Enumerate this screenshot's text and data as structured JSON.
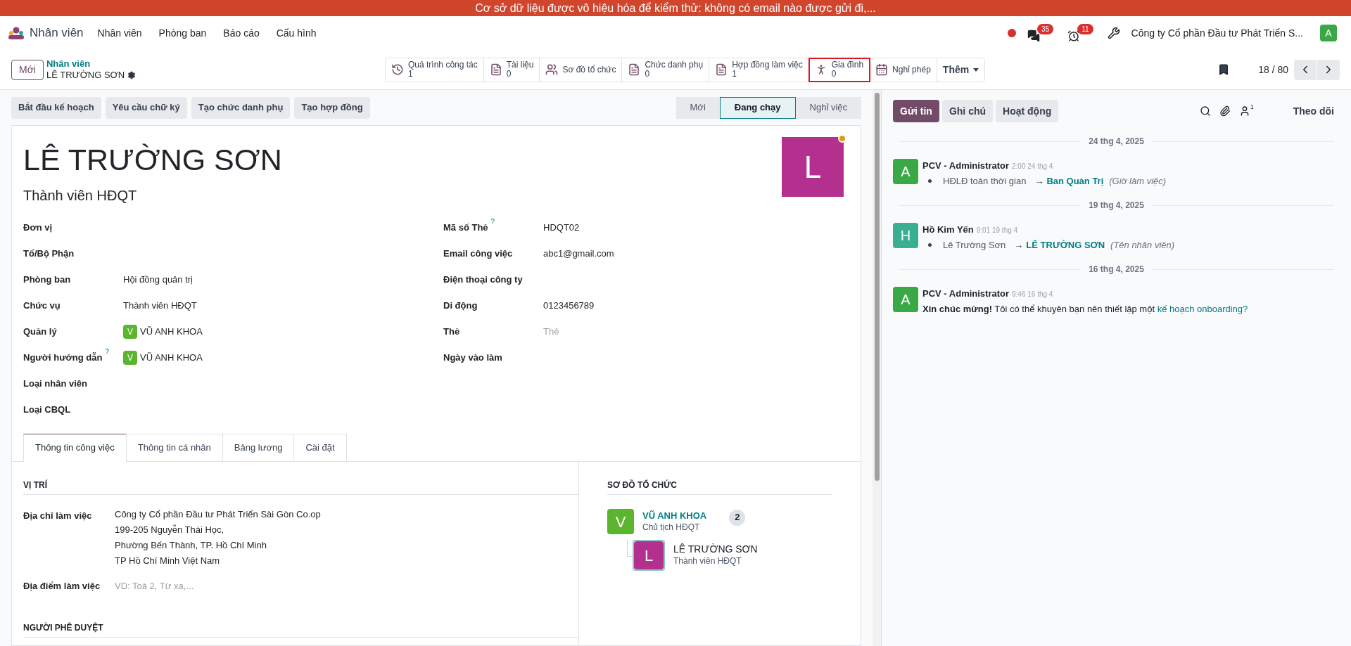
{
  "banner": "Cơ sở dữ liệu được vô hiệu hóa để kiểm thử: không có email nào được gửi đi,...",
  "navbar": {
    "app": "Nhân viên",
    "menu": [
      "Nhân viên",
      "Phòng ban",
      "Báo cáo",
      "Cấu hình"
    ],
    "messages_badge": "35",
    "activities_badge": "11",
    "company": "Công ty Cổ phần Đầu tư Phát Triển S...",
    "user_avatar": "A"
  },
  "control_panel": {
    "new_button": "Mới",
    "breadcrumb": "Nhân viên",
    "record": "LÊ TRƯỜNG SƠN",
    "pager": "18 / 80",
    "smart_buttons": [
      {
        "kind": "stat",
        "label": "Quá trình công tác",
        "count": "1",
        "highlighted": false
      },
      {
        "kind": "stat",
        "label": "Tài liệu",
        "count": "0",
        "highlighted": false
      },
      {
        "kind": "plain",
        "label": "Sơ đồ tổ chức",
        "highlighted": false
      },
      {
        "kind": "stat",
        "label": "Chức danh phụ",
        "count": "0",
        "highlighted": false
      },
      {
        "kind": "stat",
        "label": "Hợp đồng làm việc",
        "count": "1",
        "highlighted": false
      },
      {
        "kind": "stat",
        "label": "Gia đình",
        "count": "0",
        "highlighted": true
      },
      {
        "kind": "plain",
        "label": "Nghỉ phép",
        "highlighted": false
      },
      {
        "kind": "more",
        "label": "Thêm",
        "highlighted": false
      }
    ]
  },
  "action_buttons": [
    "Bắt đầu kế hoạch",
    "Yêu cầu chữ ký",
    "Tạo chức danh phụ",
    "Tạo hợp đồng"
  ],
  "status_stages": [
    {
      "label": "Mới",
      "selected": false
    },
    {
      "label": "Đang chạy",
      "selected": true
    },
    {
      "label": "Nghỉ việc",
      "selected": false
    }
  ],
  "employee": {
    "name": "LÊ TRƯỜNG SƠN",
    "job_title": "Thành viên HĐQT",
    "avatar": "L",
    "status_dot": true
  },
  "fields_left": [
    {
      "kind": "text",
      "label": "Đơn vị"
    },
    {
      "kind": "text",
      "label": "Tổ/Bộ Phận"
    },
    {
      "kind": "text",
      "label": "Phòng ban",
      "value": "Hội đồng quản trị"
    },
    {
      "kind": "text",
      "label": "Chức vụ",
      "value": "Thành viên HĐQT"
    },
    {
      "kind": "person",
      "label": "Quản lý",
      "avatar": "V",
      "value": "VŨ ANH KHOA"
    },
    {
      "kind": "person",
      "label": "Người hướng dẫn",
      "help": "?",
      "avatar": "V",
      "value": "VŨ ANH KHOA"
    },
    {
      "kind": "text",
      "label": "Loại nhân viên"
    },
    {
      "kind": "text",
      "label": "Loại CBQL"
    }
  ],
  "fields_right": [
    {
      "kind": "text",
      "label": "Mã số Thẻ",
      "help": "?",
      "value": "HDQT02"
    },
    {
      "kind": "text",
      "label": "Email công việc",
      "value": "abc1@gmail.com"
    },
    {
      "kind": "text",
      "label": "Điện thoại công ty"
    },
    {
      "kind": "text",
      "label": "Di động",
      "value": "0123456789"
    },
    {
      "kind": "placeholder",
      "label": "Thẻ",
      "placeholder": "Thẻ"
    },
    {
      "kind": "text",
      "label": "Ngày vào làm"
    }
  ],
  "tabs": [
    {
      "label": "Thông tin công việc",
      "selected": true
    },
    {
      "label": "Thông tin cá nhân",
      "selected": false
    },
    {
      "label": "Bảng lương",
      "selected": false
    },
    {
      "label": "Cài đặt",
      "selected": false
    }
  ],
  "work_info": {
    "section_position": "VỊ TRÍ",
    "address_label": "Địa chỉ làm việc",
    "address_lines": [
      "Công ty Cổ phần Đầu tư Phát Triển Sài Gòn Co.op",
      "199-205 Nguyễn Thái Học,",
      "Phường Bến Thành, TP. Hồ Chí Minh",
      "TP Hồ Chí Minh Việt Nam"
    ],
    "location_label": "Địa điểm làm việc",
    "location_placeholder": "VD: Toà 2, Từ xa,...",
    "section_approvers": "NGƯỜI PHÊ DUYỆT"
  },
  "org_chart": {
    "title": "SƠ ĐỒ TỔ CHỨC",
    "manager": {
      "avatar": "V",
      "name": "VŨ ANH KHOA",
      "title": "Chủ tịch HĐQT",
      "count": "2"
    },
    "employee": {
      "avatar": "L",
      "name": "LÊ TRƯỜNG SƠN",
      "title": "Thành viên HĐQT"
    }
  },
  "chatter": {
    "buttons": [
      {
        "label": "Gửi tin",
        "selected": true
      },
      {
        "label": "Ghi chú",
        "selected": false
      },
      {
        "label": "Hoạt động",
        "selected": false
      }
    ],
    "followers_count": "1",
    "follow": "Theo dõi",
    "entries": [
      {
        "kind": "date",
        "label": "24 thg 4, 2025"
      },
      {
        "kind": "change",
        "avatar": "A",
        "color": "#3aa845",
        "author": "PCV - Administrator",
        "time": "2:00 24 thg 4",
        "old": "HĐLĐ toàn thời gian",
        "arrow": "→",
        "new": "Ban Quản Trị",
        "field": "(Giờ làm việc)"
      },
      {
        "kind": "date",
        "label": "19 thg 4, 2025"
      },
      {
        "kind": "change",
        "avatar": "H",
        "color": "#3aae90",
        "author": "Hồ Kim Yến",
        "time": "9:01 19 thg 4",
        "old": "Lê Trường Sơn",
        "arrow": "→",
        "new": "LÊ TRƯỜNG SƠN",
        "field": "(Tên nhân viên)"
      },
      {
        "kind": "date",
        "label": "16 thg 4, 2025"
      },
      {
        "kind": "text",
        "avatar": "A",
        "color": "#3aa845",
        "author": "PCV - Administrator",
        "time": "9:46 16 thg 4",
        "body": "**Xin chúc mừng!** Tôi có thể khuyên bạn nên thiết lập một",
        "link": "kế hoạch onboarding?"
      }
    ]
  }
}
